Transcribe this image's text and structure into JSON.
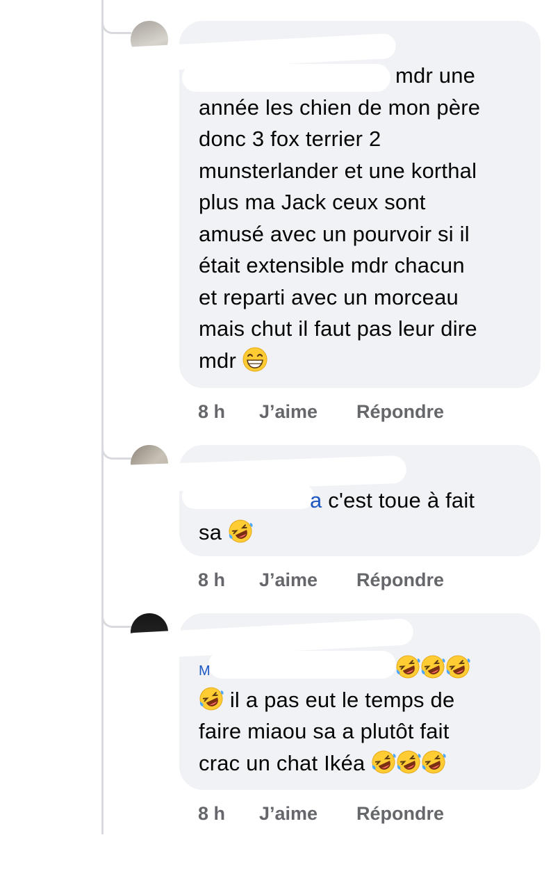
{
  "comments": [
    {
      "author": "",
      "mention": "",
      "lines": [
        "mdr une",
        "année les chien de mon père",
        "donc 3 fox terrier 2",
        "munsterlander et une korthal",
        "plus ma Jack ceux sont",
        "amusé avec un pourvoir si il",
        "était extensible mdr chacun",
        "et reparti avec un morceau",
        "mais chut il faut pas leur dire",
        "mdr"
      ],
      "end_emoji": "grinning-face-with-smiling-eyes",
      "time": "8 h",
      "like": "J’aime",
      "reply": "Répondre"
    },
    {
      "author": "",
      "mention": "a",
      "lines": [
        "c'est toue à fait",
        "sa"
      ],
      "end_emoji": "rolling-on-the-floor-laughing",
      "time": "8 h",
      "like": "J’aime",
      "reply": "Répondre"
    },
    {
      "author": "",
      "mention": "M",
      "lines": [
        "",
        "il a pas eut le temps de",
        "faire miaou sa a plutôt fait",
        "crac un chat Ikéa"
      ],
      "end_emoji": "rolling-on-the-floor-laughing",
      "time": "8 h",
      "like": "J’aime",
      "reply": "Répondre"
    }
  ]
}
